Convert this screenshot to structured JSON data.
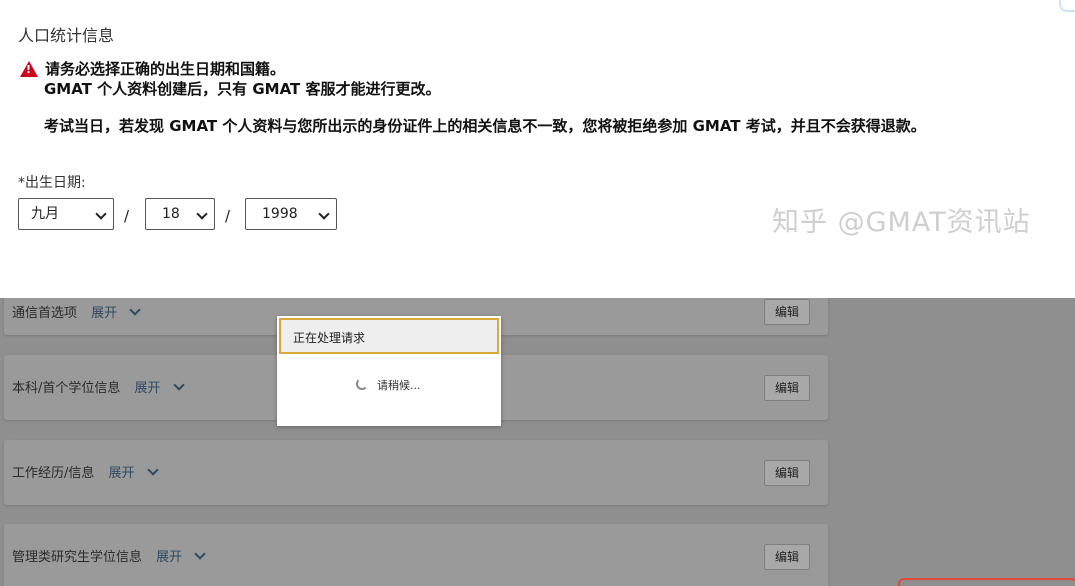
{
  "demographics": {
    "section_title": "人口统计信息",
    "warning_line1": "请务必选择正确的出生日期和国籍。",
    "warning_line2": "GMAT 个人资料创建后，只有 GMAT 客服才能进行更改。",
    "warning_line3": "考试当日，若发现 GMAT 个人资料与您所出示的身份证件上的相关信息不一致，您将被拒绝参加 GMAT 考试，并且不会获得退款。",
    "dob_label": "*出生日期:",
    "month_value": "九月",
    "day_value": "18",
    "year_value": "1998",
    "separator": "/"
  },
  "watermark": "知乎 @GMAT资讯站",
  "sections": [
    {
      "label": "通信首选项",
      "expand": "展开",
      "edit": "编辑"
    },
    {
      "label": "本科/首个学位信息",
      "expand": "展开",
      "edit": "编辑"
    },
    {
      "label": "工作经历/信息",
      "expand": "展开",
      "edit": "编辑"
    },
    {
      "label": "管理类研究生学位信息",
      "expand": "展开",
      "edit": "编辑"
    }
  ],
  "modal": {
    "title": "正在处理请求",
    "message": "请稍候..."
  },
  "colors": {
    "warning_red": "#d0021b",
    "overlay_grey": "#8f8f8f",
    "modal_header_border": "#d9a93a",
    "expand_link": "#2e4a63"
  }
}
